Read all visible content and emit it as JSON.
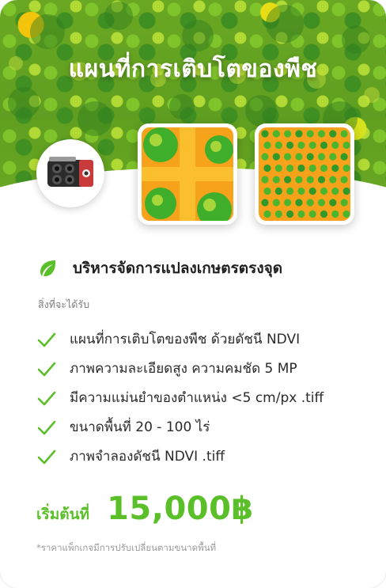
{
  "hero": {
    "title": "แผนที่การเติบโตของพืช"
  },
  "product": {
    "camera_icon": "multispectral-camera-icon",
    "map_images": [
      "ndvi-crop-cluster-map",
      "ndvi-plant-grid-map"
    ]
  },
  "section": {
    "icon": "leaf-icon",
    "title": "บริหารจัดการแปลงเกษตรตรงจุด"
  },
  "subhead": "สิ่งที่จะได้รับ",
  "features": [
    "แผนที่การเติบโตของพืช ด้วยดัชนี NDVI",
    "ภาพความละเอียดสูง ความคมชัด 5 MP",
    "มีความแม่นยำของตำแหน่ง <5 cm/px .tiff",
    "ขนาดพื้นที่  20 - 100 ไร่",
    "ภาพจำลองดัชนี NDVI .tiff"
  ],
  "price": {
    "label": "เริ่มต้นที่",
    "value": "15,000฿"
  },
  "footnote": "*ราคาแพ็กเกจมีการปรับเปลี่ยนตามขนาดพื้นที่",
  "colors": {
    "accent_green": "#5bbf2a",
    "ndvi_orange": "#f7a21b",
    "ndvi_green": "#3fae2a"
  }
}
